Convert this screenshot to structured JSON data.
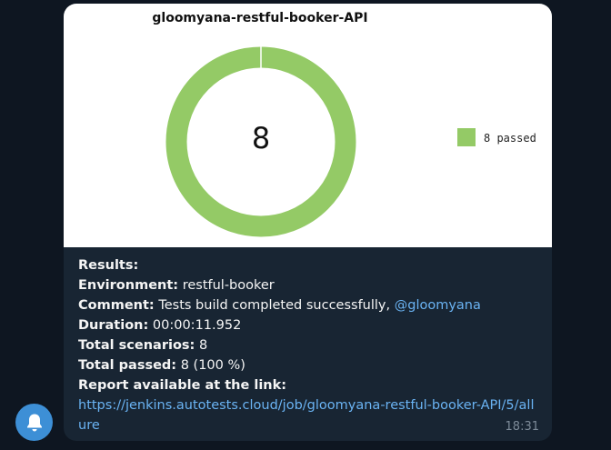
{
  "message": {
    "chart": {
      "title": "gloomyana-restful-booker-API",
      "center_label": "8",
      "legend": "8 passed",
      "color_passed": "#94ca66"
    },
    "results_label": "Results:",
    "environment_label": "Environment:",
    "environment_value": "restful-booker",
    "comment_label": "Comment:",
    "comment_value": "Tests build completed successfully,",
    "comment_mention": "@gloomyana",
    "duration_label": "Duration:",
    "duration_value": "00:00:11.952",
    "total_scenarios_label": "Total scenarios:",
    "total_scenarios_value": "8",
    "total_passed_label": "Total passed:",
    "total_passed_value": "8 (100 %)",
    "report_label": "Report available at the link:",
    "report_url": "https://jenkins.autotests.cloud/job/gloomyana-restful-booker-API/5/allure",
    "time": "18:31"
  },
  "notification_icon": "bell-icon",
  "chart_data": {
    "type": "pie",
    "title": "gloomyana-restful-booker-API",
    "categories": [
      "passed"
    ],
    "values": [
      8
    ],
    "legend": [
      "8 passed"
    ],
    "legend_position": "right",
    "center_value": "8",
    "colors": [
      "#94ca66"
    ]
  }
}
